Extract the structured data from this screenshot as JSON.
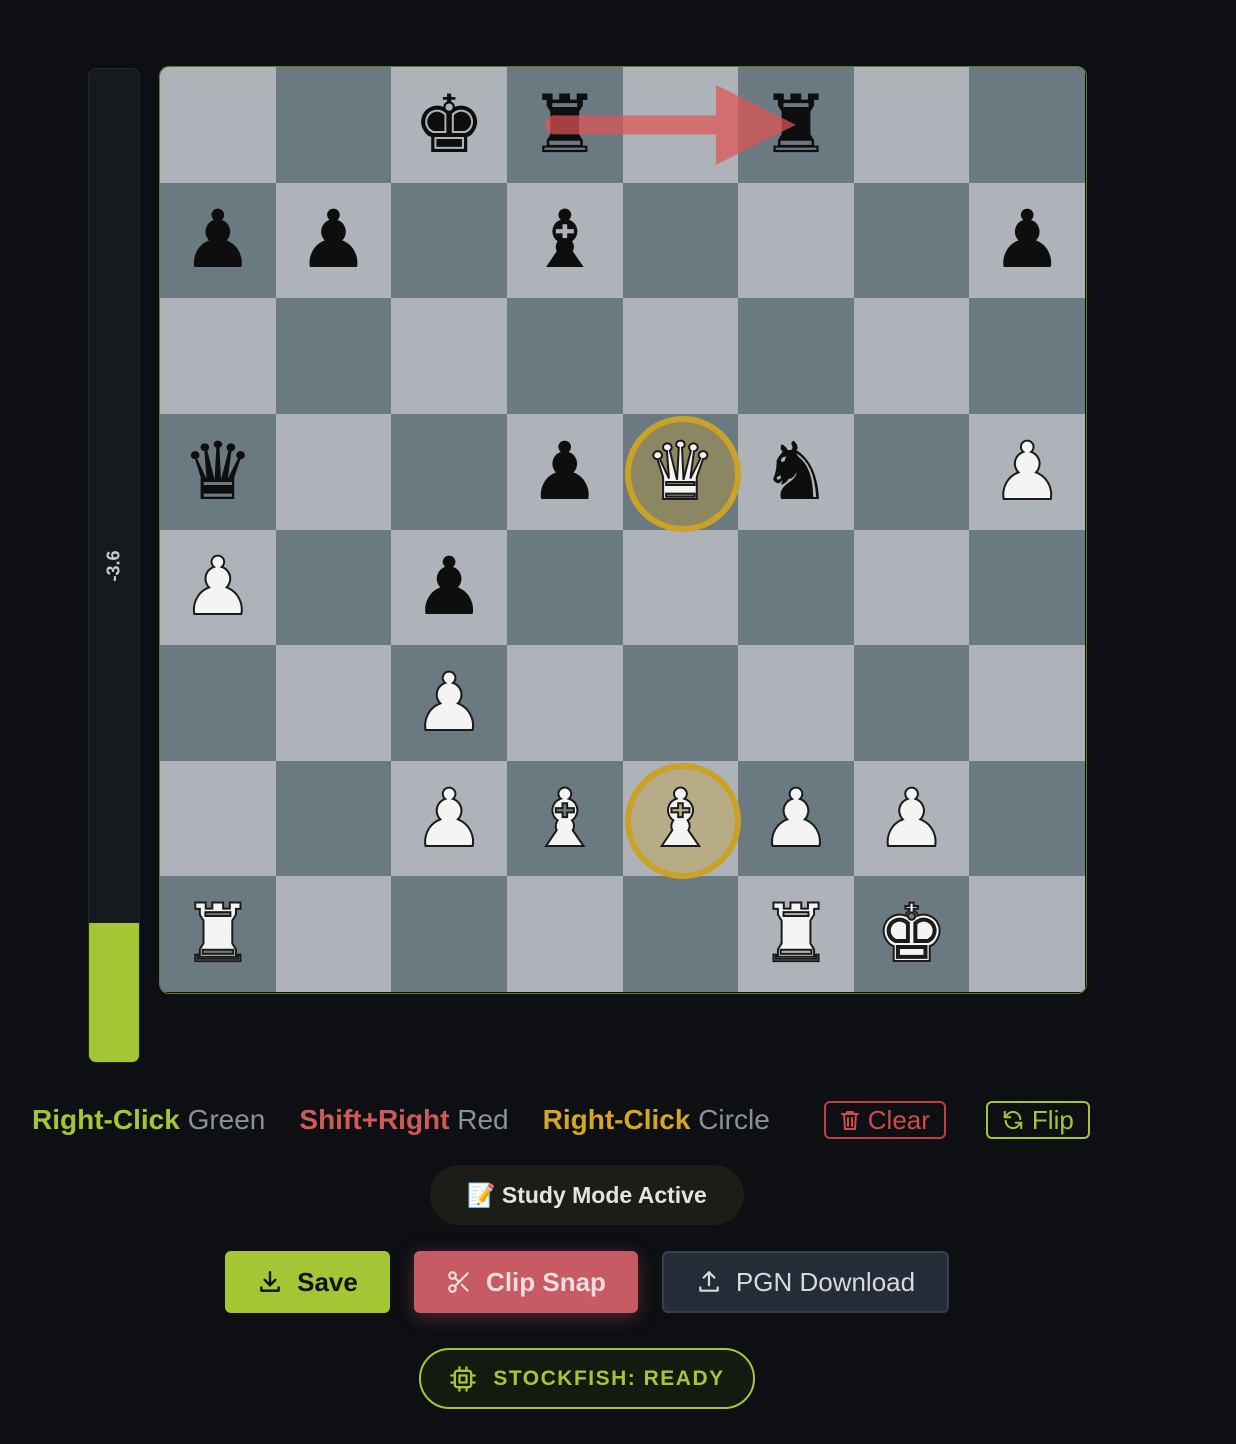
{
  "eval": {
    "score_label": "-3.6",
    "white_share": 0.14,
    "fill_color": "#a5c634"
  },
  "board": {
    "orientation": "white-bottom",
    "fen": "2kr1r2/pp1b3p/8/q2pQn1P/P1p5/2P5/2PBBPP1/R4RK1",
    "light_color": "#adb3b9",
    "dark_color": "#6b7981",
    "pieces": [
      {
        "square": "c8",
        "type": "king",
        "color": "black",
        "glyph": "♚",
        "icon": "black-king-icon"
      },
      {
        "square": "d8",
        "type": "rook",
        "color": "black",
        "glyph": "♜",
        "icon": "black-rook-icon"
      },
      {
        "square": "f8",
        "type": "rook",
        "color": "black",
        "glyph": "♜",
        "icon": "black-rook-icon"
      },
      {
        "square": "a7",
        "type": "pawn",
        "color": "black",
        "glyph": "♟",
        "icon": "black-pawn-icon"
      },
      {
        "square": "b7",
        "type": "pawn",
        "color": "black",
        "glyph": "♟",
        "icon": "black-pawn-icon"
      },
      {
        "square": "d7",
        "type": "bishop",
        "color": "black",
        "glyph": "♝",
        "icon": "black-bishop-icon"
      },
      {
        "square": "h7",
        "type": "pawn",
        "color": "black",
        "glyph": "♟",
        "icon": "black-pawn-icon"
      },
      {
        "square": "a5",
        "type": "queen",
        "color": "black",
        "glyph": "♛",
        "icon": "black-queen-icon"
      },
      {
        "square": "d5",
        "type": "pawn",
        "color": "black",
        "glyph": "♟",
        "icon": "black-pawn-icon"
      },
      {
        "square": "e5",
        "type": "queen",
        "color": "white",
        "glyph": "♛",
        "icon": "white-queen-icon"
      },
      {
        "square": "f5",
        "type": "knight",
        "color": "black",
        "glyph": "♞",
        "icon": "black-knight-icon"
      },
      {
        "square": "h5",
        "type": "pawn",
        "color": "white",
        "glyph": "♟",
        "icon": "white-pawn-icon"
      },
      {
        "square": "a4",
        "type": "pawn",
        "color": "white",
        "glyph": "♟",
        "icon": "white-pawn-icon"
      },
      {
        "square": "c4",
        "type": "pawn",
        "color": "black",
        "glyph": "♟",
        "icon": "black-pawn-icon"
      },
      {
        "square": "c3",
        "type": "pawn",
        "color": "white",
        "glyph": "♟",
        "icon": "white-pawn-icon"
      },
      {
        "square": "c2",
        "type": "pawn",
        "color": "white",
        "glyph": "♟",
        "icon": "white-pawn-icon"
      },
      {
        "square": "d2",
        "type": "bishop",
        "color": "white",
        "glyph": "♝",
        "icon": "white-bishop-icon"
      },
      {
        "square": "e2",
        "type": "bishop",
        "color": "white",
        "glyph": "♝",
        "icon": "white-bishop-icon"
      },
      {
        "square": "f2",
        "type": "pawn",
        "color": "white",
        "glyph": "♟",
        "icon": "white-pawn-icon"
      },
      {
        "square": "g2",
        "type": "pawn",
        "color": "white",
        "glyph": "♟",
        "icon": "white-pawn-icon"
      },
      {
        "square": "a1",
        "type": "rook",
        "color": "white",
        "glyph": "♜",
        "icon": "white-rook-icon"
      },
      {
        "square": "f1",
        "type": "rook",
        "color": "white",
        "glyph": "♜",
        "icon": "white-rook-icon"
      },
      {
        "square": "g1",
        "type": "king",
        "color": "white",
        "glyph": "♚",
        "icon": "white-king-icon"
      }
    ],
    "circles": [
      {
        "square": "e5",
        "color": "#c9a227"
      },
      {
        "square": "e2",
        "color": "#c9a227"
      }
    ],
    "arrows": [
      {
        "from": "d8",
        "to": "f8",
        "color": "#e05555"
      }
    ]
  },
  "legend": {
    "green_key": "Right-Click",
    "green_value": "Green",
    "red_key": "Shift+Right",
    "red_value": "Red",
    "circle_key": "Right-Click",
    "circle_value": "Circle",
    "clear_label": "Clear",
    "clear_icon": "trash-icon",
    "flip_label": "Flip",
    "flip_icon": "refresh-icon"
  },
  "study": {
    "emoji": "📝",
    "label": "Study Mode Active"
  },
  "actions": {
    "save_label": "Save",
    "save_icon": "download-icon",
    "clip_label": "Clip Snap",
    "clip_icon": "scissors-icon",
    "pgn_label": "PGN Download",
    "pgn_icon": "upload-icon"
  },
  "engine": {
    "status_label": "STOCKFISH: READY",
    "icon": "cpu-icon"
  },
  "colors": {
    "accent_green": "#a5c634",
    "accent_red": "#d05a5a",
    "accent_gold": "#d4a626",
    "background": "#0d0f13"
  }
}
